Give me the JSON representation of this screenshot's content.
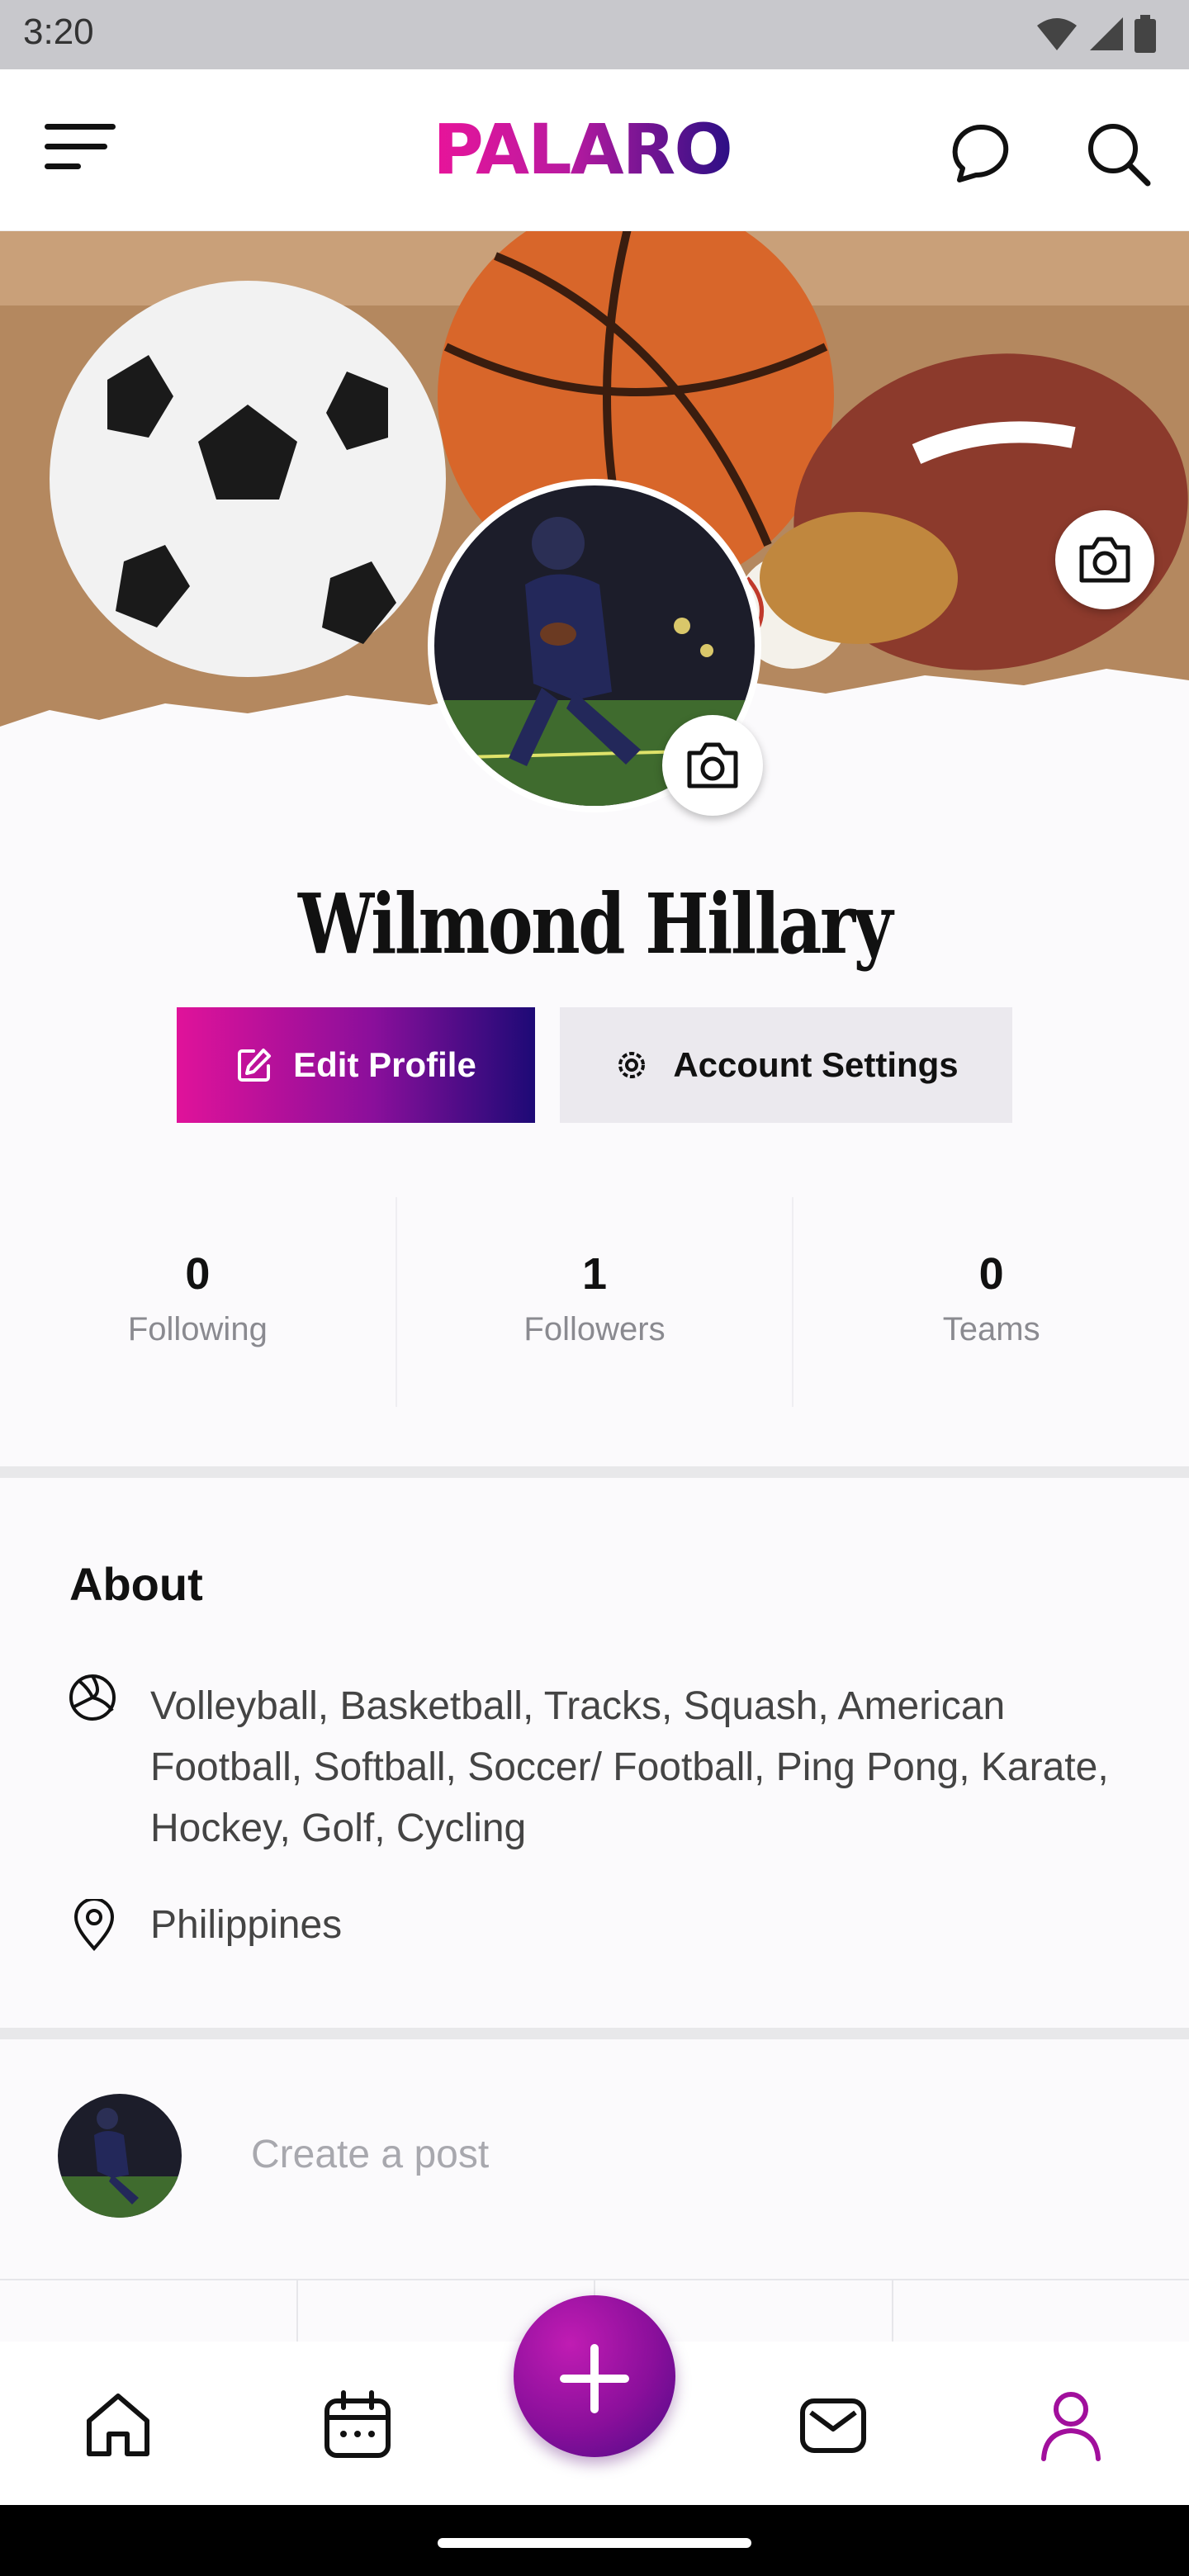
{
  "status_bar": {
    "time": "3:20"
  },
  "header": {
    "logo_text": "PALARO"
  },
  "profile": {
    "name": "Wilmond Hillary"
  },
  "actions": {
    "edit_label": "Edit Profile",
    "settings_label": "Account Settings"
  },
  "stats": [
    {
      "value": "0",
      "label": "Following"
    },
    {
      "value": "1",
      "label": "Followers"
    },
    {
      "value": "0",
      "label": "Teams"
    }
  ],
  "about": {
    "title": "About",
    "sports": "Volleyball, Basketball, Tracks, Squash, American Football, Softball, Soccer/ Football, Ping Pong, Karate, Hockey, Golf, Cycling",
    "location": "Philippines"
  },
  "composer": {
    "placeholder": "Create a post"
  },
  "colors": {
    "brand_pink": "#e0129a",
    "brand_purple": "#8a0f9b",
    "brand_navy": "#1d0a76"
  },
  "icons": [
    "wifi-icon",
    "signal-icon",
    "battery-icon",
    "menu-icon",
    "chat-icon",
    "search-icon",
    "camera-icon",
    "edit-icon",
    "gear-icon",
    "volleyball-icon",
    "location-pin-icon",
    "home-icon",
    "calendar-icon",
    "plus-icon",
    "mail-icon",
    "profile-icon"
  ]
}
